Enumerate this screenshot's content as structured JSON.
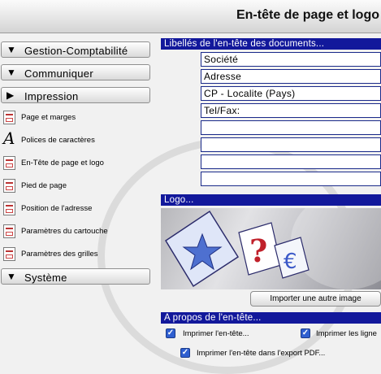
{
  "window": {
    "title": "En-tête de page et logo"
  },
  "sidebar": {
    "sections": [
      {
        "label": "Gestion-Comptabilité",
        "arrow": "▼"
      },
      {
        "label": "Communiquer",
        "arrow": "▼"
      },
      {
        "label": "Impression",
        "arrow": "▶"
      },
      {
        "label": "Système",
        "arrow": "▼"
      }
    ],
    "impression_items": [
      {
        "label": "Page et marges",
        "icon": "page-margins-icon"
      },
      {
        "label": "Polices de caractères",
        "icon": "font-icon",
        "glyph": "A"
      },
      {
        "label": "En-Tête de page et logo",
        "icon": "header-logo-icon"
      },
      {
        "label": "Pied de page",
        "icon": "footer-icon"
      },
      {
        "label": "Position de l'adresse",
        "icon": "address-position-icon"
      },
      {
        "label": "Paramètres du cartouche",
        "icon": "cartouche-icon"
      },
      {
        "label": "Paramètres des grilles",
        "icon": "grid-icon"
      }
    ]
  },
  "main": {
    "header_labels_title": "Libellés de l'en-tête des documents...",
    "header_fields": [
      "Société",
      "Adresse",
      "CP - Localite (Pays)",
      "Tel/Fax:",
      "",
      "",
      "",
      ""
    ],
    "logo_title": "Logo...",
    "import_button": "Importer une autre image",
    "about_title": "A propos de l'en-tête...",
    "options": [
      {
        "label": "Imprimer l'en-tête...",
        "checked": true
      },
      {
        "label": "Imprimer les ligne",
        "checked": true
      },
      {
        "label": "Imprimer l'en-tête dans l'export PDF...",
        "checked": true
      }
    ]
  },
  "colors": {
    "accent_bar": "#12189b",
    "checkbox": "#2f5fd0"
  }
}
